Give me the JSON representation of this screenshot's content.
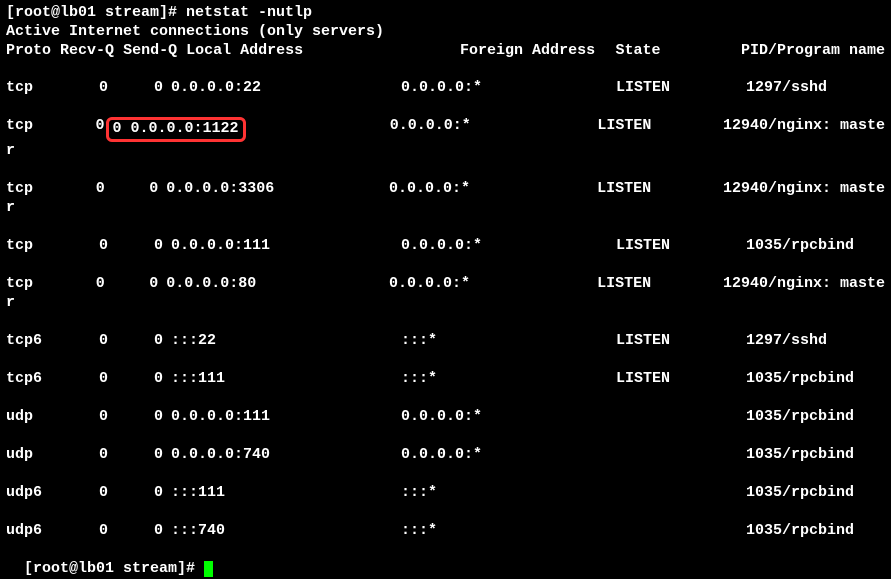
{
  "prompt1": "[root@lb01 stream]# netstat -nutlp",
  "activeLine": "Active Internet connections (only servers)",
  "headers": {
    "proto": "Proto",
    "recvq": "Recv-Q",
    "sendq": "Send-Q",
    "local": "Local Address",
    "foreign": "Foreign Address",
    "state": "State",
    "pid": "PID/Program name"
  },
  "rows": [
    {
      "proto": "tcp",
      "recvq": "0",
      "sendq": "0",
      "local": "0.0.0.0:22",
      "foreign": "0.0.0.0:*",
      "state": "LISTEN",
      "pid": "1297/sshd",
      "gap": true,
      "wrap": "",
      "highlight": false
    },
    {
      "proto": "tcp",
      "recvq": "0",
      "sendq": "0",
      "local": "0.0.0.0:1122",
      "foreign": "0.0.0.0:*",
      "state": "LISTEN",
      "pid": "12940/nginx: maste",
      "gap": false,
      "wrap": "r",
      "highlight": true
    },
    {
      "proto": "tcp",
      "recvq": "0",
      "sendq": "0",
      "local": "0.0.0.0:3306",
      "foreign": "0.0.0.0:*",
      "state": "LISTEN",
      "pid": "12940/nginx: maste",
      "gap": false,
      "wrap": "r",
      "highlight": false
    },
    {
      "proto": "tcp",
      "recvq": "0",
      "sendq": "0",
      "local": "0.0.0.0:111",
      "foreign": "0.0.0.0:*",
      "state": "LISTEN",
      "pid": "1035/rpcbind",
      "gap": true,
      "wrap": "",
      "highlight": false
    },
    {
      "proto": "tcp",
      "recvq": "0",
      "sendq": "0",
      "local": "0.0.0.0:80",
      "foreign": "0.0.0.0:*",
      "state": "LISTEN",
      "pid": "12940/nginx: maste",
      "gap": false,
      "wrap": "r",
      "highlight": false
    },
    {
      "proto": "tcp6",
      "recvq": "0",
      "sendq": "0",
      "local": ":::22",
      "foreign": ":::*",
      "state": "LISTEN",
      "pid": "1297/sshd",
      "gap": true,
      "wrap": "",
      "highlight": false
    },
    {
      "proto": "tcp6",
      "recvq": "0",
      "sendq": "0",
      "local": ":::111",
      "foreign": ":::*",
      "state": "LISTEN",
      "pid": "1035/rpcbind",
      "gap": true,
      "wrap": "",
      "highlight": false
    },
    {
      "proto": "udp",
      "recvq": "0",
      "sendq": "0",
      "local": "0.0.0.0:111",
      "foreign": "0.0.0.0:*",
      "state": "",
      "pid": "1035/rpcbind",
      "gap": true,
      "wrap": "",
      "highlight": false
    },
    {
      "proto": "udp",
      "recvq": "0",
      "sendq": "0",
      "local": "0.0.0.0:740",
      "foreign": "0.0.0.0:*",
      "state": "",
      "pid": "1035/rpcbind",
      "gap": true,
      "wrap": "",
      "highlight": false
    },
    {
      "proto": "udp6",
      "recvq": "0",
      "sendq": "0",
      "local": ":::111",
      "foreign": ":::*",
      "state": "",
      "pid": "1035/rpcbind",
      "gap": true,
      "wrap": "",
      "highlight": false
    },
    {
      "proto": "udp6",
      "recvq": "0",
      "sendq": "0",
      "local": ":::740",
      "foreign": ":::*",
      "state": "",
      "pid": "1035/rpcbind",
      "gap": true,
      "wrap": "",
      "highlight": false
    }
  ],
  "prompt2": "[root@lb01 stream]# "
}
